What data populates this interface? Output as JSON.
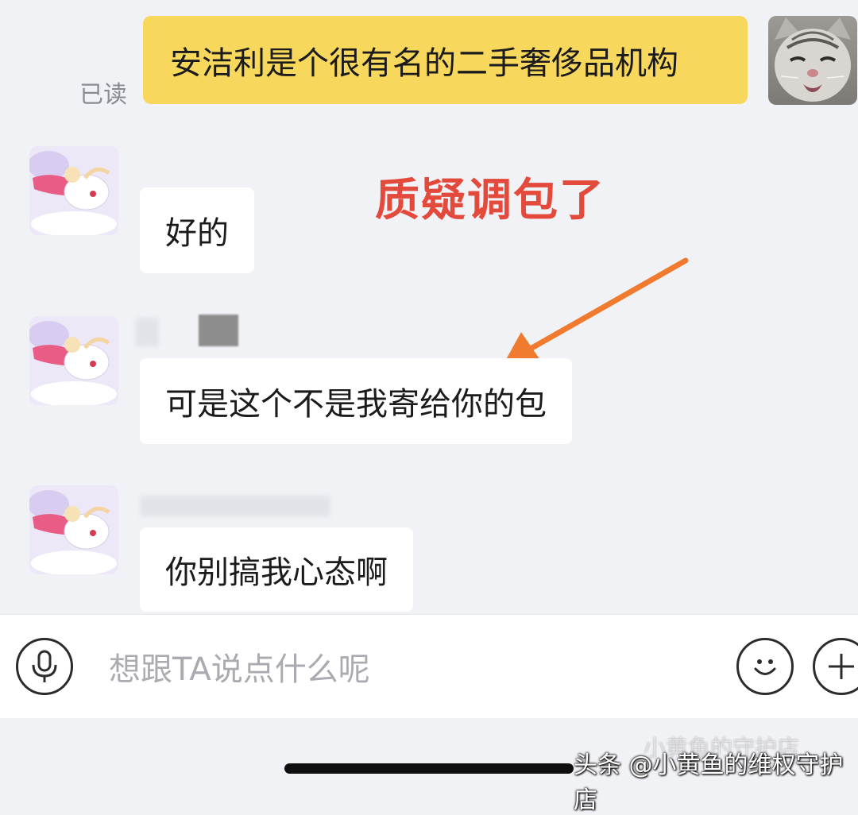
{
  "conversation": {
    "outgoing": {
      "text": "安洁利是个很有名的二手奢侈品机构",
      "read_status": "已读"
    },
    "incoming": [
      {
        "text": "好的"
      },
      {
        "text": "可是这个不是我寄给你的包"
      },
      {
        "text": "你别搞我心态啊"
      }
    ]
  },
  "annotation": {
    "text": "质疑调包了",
    "color": "#e34a3c",
    "arrow_color": "#f07a2e"
  },
  "input_bar": {
    "placeholder": "想跟TA说点什么呢",
    "voice_icon": "microphone-icon",
    "emoji_icon": "smiley-icon",
    "more_icon": "plus-icon"
  },
  "watermark": {
    "text": "头条 @小黄鱼的维权守护店",
    "faint_text": "小黄鱼的守护店"
  },
  "colors": {
    "background": "#f1f2f6",
    "outgoing_bubble": "#f7d75c",
    "incoming_bubble": "#ffffff"
  }
}
